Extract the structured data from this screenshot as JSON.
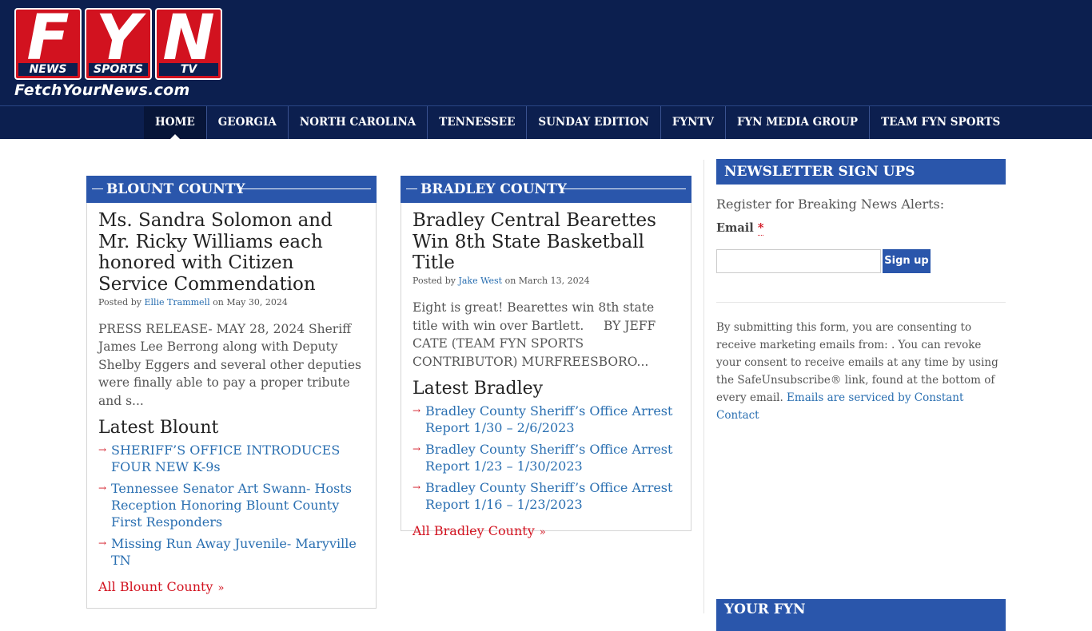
{
  "logo": {
    "letters": [
      "F",
      "Y",
      "N"
    ],
    "subs": [
      "NEWS",
      "SPORTS",
      "TV"
    ],
    "site": "FetchYourNews.com"
  },
  "nav": [
    "HOME",
    "GEORGIA",
    "NORTH CAROLINA",
    "TENNESSEE",
    "SUNDAY EDITION",
    "FYNTV",
    "FYN MEDIA GROUP",
    "TEAM FYN SPORTS"
  ],
  "blount": {
    "heading": "BLOUNT COUNTY",
    "title": "Ms. Sandra Solomon and Mr. Ricky Williams each honored with Citizen Service Commendation",
    "byline_prefix": "Posted by",
    "author": "Ellie Trammell",
    "date": "on May 30, 2024",
    "excerpt": "PRESS RELEASE- MAY 28, 2024 Sheriff James Lee Berrong along with Deputy Shelby Eggers and several other deputies were finally able to pay a proper tribute and s...",
    "latest": "Latest Blount",
    "links": [
      "SHERIFF’S OFFICE INTRODUCES FOUR NEW K-9s",
      "Tennessee Senator Art Swann- Hosts Reception Honoring Blount County First Responders",
      "Missing Run Away Juvenile- Maryville TN"
    ],
    "all": "All Blount County"
  },
  "bradley": {
    "heading": "BRADLEY COUNTY",
    "title": "Bradley Central Bearettes Win 8th State Basketball Title",
    "byline_prefix": "Posted by",
    "author": "Jake West",
    "date": "on March 13, 2024",
    "excerpt": "Eight is great! Bearettes win 8th state title with win over Bartlett.     BY JEFF CATE (TEAM FYN SPORTS CONTRIBUTOR) MURFREESBORO...",
    "latest": "Latest Bradley",
    "links": [
      "Bradley County Sheriff’s Office Arrest Report 1/30 – 2/6/2023",
      "Bradley County Sheriff’s Office Arrest Report 1/23 – 1/30/2023",
      "Bradley County Sheriff’s Office Arrest Report 1/16 – 1/23/2023"
    ],
    "all": "All Bradley County"
  },
  "newsletter": {
    "heading": "NEWSLETTER SIGN UPS",
    "intro": "Register for Breaking News Alerts:",
    "email_label": "Email",
    "required_mark": "*",
    "email_value": "",
    "button": "Sign up",
    "consent": "By submitting this form, you are consenting to receive marketing emails from: . You can revoke your consent to receive emails at any time by using the SafeUnsubscribe® link, found at the bottom of every email.",
    "consent_link": "Emails are serviced by Constant Contact"
  },
  "your_fyn": {
    "heading": "YOUR FYN"
  },
  "colors": {
    "navy": "#0c1f4f",
    "blue": "#2a56ab",
    "red": "#d2121f",
    "link": "#2a6fb1"
  }
}
